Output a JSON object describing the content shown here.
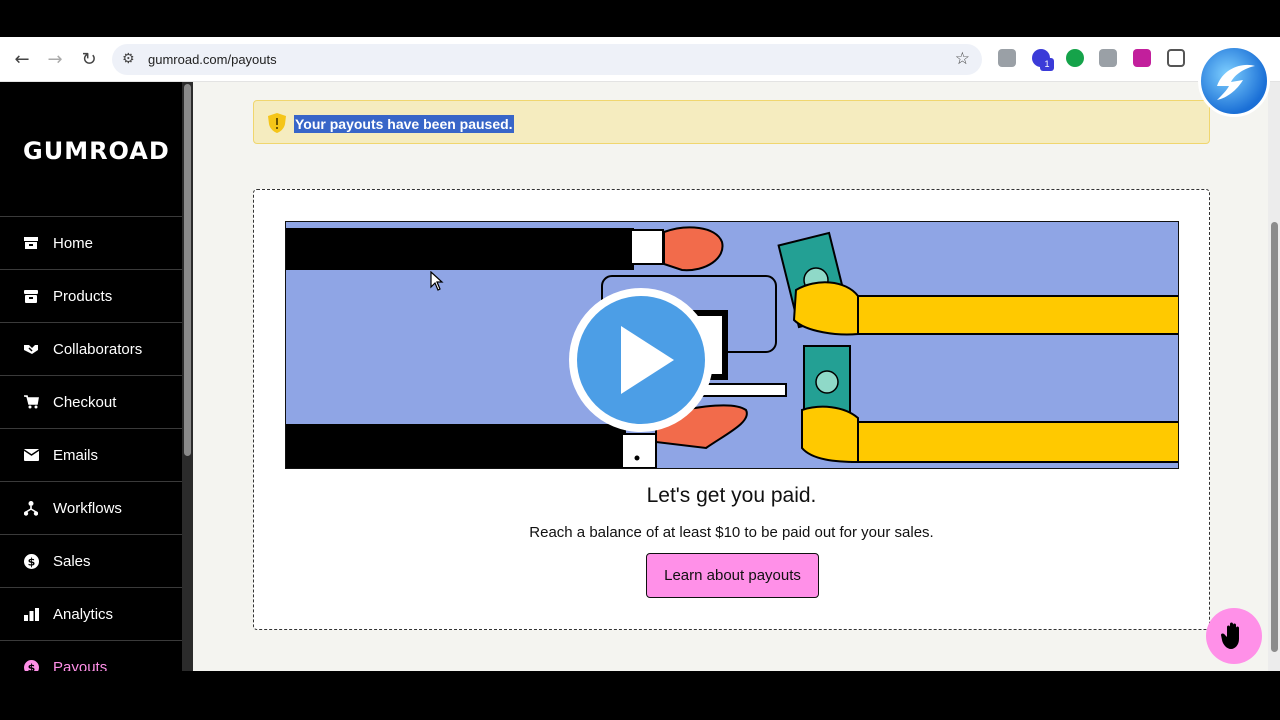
{
  "browser": {
    "url": "gumroad.com/payouts",
    "back_icon": "arrow-left-icon",
    "forward_icon": "arrow-right-icon",
    "reload_icon": "reload-icon",
    "extension_badge": "1"
  },
  "sidebar": {
    "logo": "GUMROAD",
    "items": [
      {
        "label": "Home",
        "icon": "home-icon"
      },
      {
        "label": "Products",
        "icon": "archive-icon"
      },
      {
        "label": "Collaborators",
        "icon": "handshake-icon"
      },
      {
        "label": "Checkout",
        "icon": "cart-icon"
      },
      {
        "label": "Emails",
        "icon": "envelope-icon"
      },
      {
        "label": "Workflows",
        "icon": "workflow-icon"
      },
      {
        "label": "Sales",
        "icon": "dollar-circle-icon"
      },
      {
        "label": "Analytics",
        "icon": "bar-chart-icon"
      },
      {
        "label": "Payouts",
        "icon": "dollar-circle-icon",
        "active": true
      }
    ]
  },
  "alert": {
    "message": "Your payouts have been paused.",
    "icon": "shield-warning-icon"
  },
  "card": {
    "heading": "Let's get you paid.",
    "subtext": "Reach a balance of at least $10 to be paid out for your sales.",
    "button_label": "Learn about payouts",
    "illustration_icon": "play-icon"
  },
  "colors": {
    "accent": "#ff90e8",
    "sidebar_bg": "#000000",
    "alert_bg": "#f5ecbf",
    "illustration_bg": "#8fa5e5"
  }
}
